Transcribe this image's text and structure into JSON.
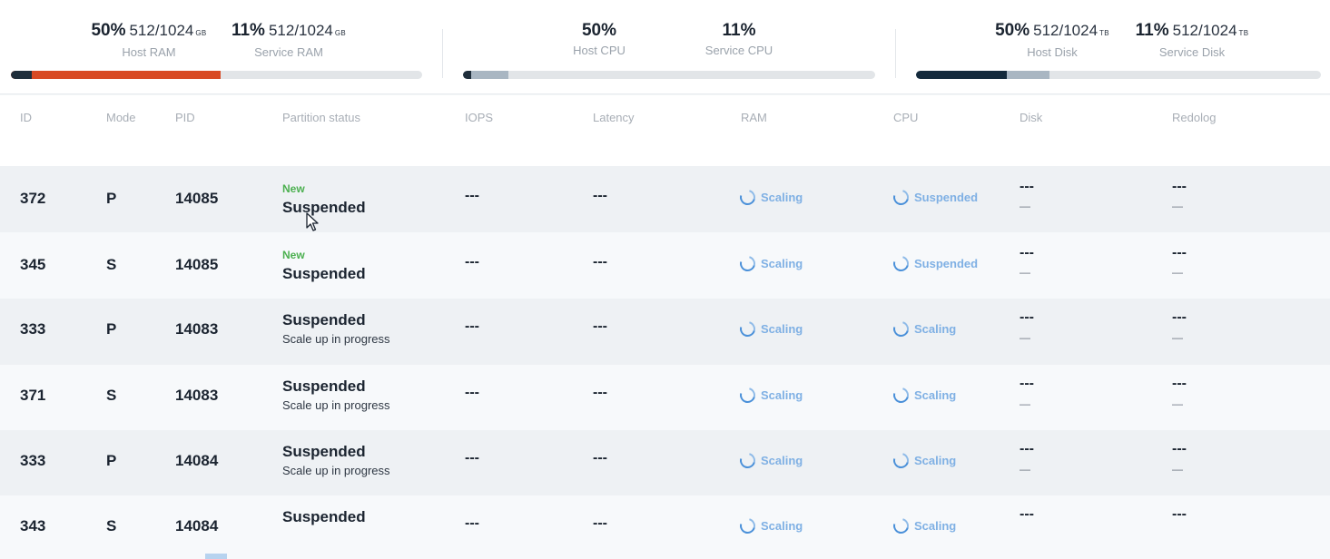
{
  "summary": {
    "ram": {
      "host": {
        "pct": "50%",
        "amount": "512/1024",
        "unit": "GB",
        "label": "Host RAM"
      },
      "service": {
        "pct": "11%",
        "amount": "512/1024",
        "unit": "GB",
        "label": "Service RAM"
      },
      "bar": {
        "service_fraction": 0.05,
        "host_fraction": 0.51,
        "service_color": "#1f2e3b",
        "host_color": "#d84a24"
      }
    },
    "cpu": {
      "host": {
        "pct": "50%",
        "label": "Host CPU"
      },
      "service": {
        "pct": "11%",
        "label": "Service CPU"
      },
      "bar": {
        "service_fraction": 0.02,
        "host_fraction": 0.11,
        "service_color": "#1f2e3b",
        "host_color": "#a9b6c2"
      }
    },
    "disk": {
      "host": {
        "pct": "50%",
        "amount": "512/1024",
        "unit": "TB",
        "label": "Host Disk"
      },
      "service": {
        "pct": "11%",
        "amount": "512/1024",
        "unit": "TB",
        "label": "Service Disk"
      },
      "bar": {
        "service_fraction": 0.225,
        "host_fraction": 0.33,
        "service_color": "#142a3c",
        "host_color": "#a9b6c2"
      }
    }
  },
  "table": {
    "columns": [
      "ID",
      "Mode",
      "PID",
      "Partition status",
      "IOPS",
      "Latency",
      "RAM",
      "CPU",
      "Disk",
      "Redolog"
    ],
    "rows": [
      {
        "id": "372",
        "mode": "P",
        "pid": "14085",
        "tag": "New",
        "status": "Suspended",
        "detail": "",
        "iops": "---",
        "latency": "---",
        "ram": "Scaling",
        "cpu": "Suspended",
        "disk": "---",
        "disk_sub": "—",
        "redolog": "---",
        "redolog_sub": "—"
      },
      {
        "id": "345",
        "mode": "S",
        "pid": "14085",
        "tag": "New",
        "status": "Suspended",
        "detail": "",
        "iops": "---",
        "latency": "---",
        "ram": "Scaling",
        "cpu": "Suspended",
        "disk": "---",
        "disk_sub": "—",
        "redolog": "---",
        "redolog_sub": "—"
      },
      {
        "id": "333",
        "mode": "P",
        "pid": "14083",
        "tag": "",
        "status": "Suspended",
        "detail": "Scale up in progress",
        "iops": "---",
        "latency": "---",
        "ram": "Scaling",
        "cpu": "Scaling",
        "disk": "---",
        "disk_sub": "—",
        "redolog": "---",
        "redolog_sub": "—"
      },
      {
        "id": "371",
        "mode": "S",
        "pid": "14083",
        "tag": "",
        "status": "Suspended",
        "detail": "Scale up in progress",
        "iops": "---",
        "latency": "---",
        "ram": "Scaling",
        "cpu": "Scaling",
        "disk": "---",
        "disk_sub": "—",
        "redolog": "---",
        "redolog_sub": "—"
      },
      {
        "id": "333",
        "mode": "P",
        "pid": "14084",
        "tag": "",
        "status": "Suspended",
        "detail": "Scale up in progress",
        "iops": "---",
        "latency": "---",
        "ram": "Scaling",
        "cpu": "Scaling",
        "disk": "---",
        "disk_sub": "—",
        "redolog": "---",
        "redolog_sub": "—"
      },
      {
        "id": "343",
        "mode": "S",
        "pid": "14084",
        "tag": "",
        "status": "Suspended",
        "detail": "",
        "iops": "---",
        "latency": "---",
        "ram": "Scaling",
        "cpu": "Scaling",
        "disk": "---",
        "disk_sub": "",
        "redolog": "---",
        "redolog_sub": ""
      }
    ]
  },
  "icons": {
    "spinner": "spinner-icon",
    "cursor": "mouse-cursor-icon"
  },
  "colors": {
    "new_tag": "#4cb050",
    "spinner": "#4a90d9",
    "spinner_label": "#7fb0e4"
  }
}
